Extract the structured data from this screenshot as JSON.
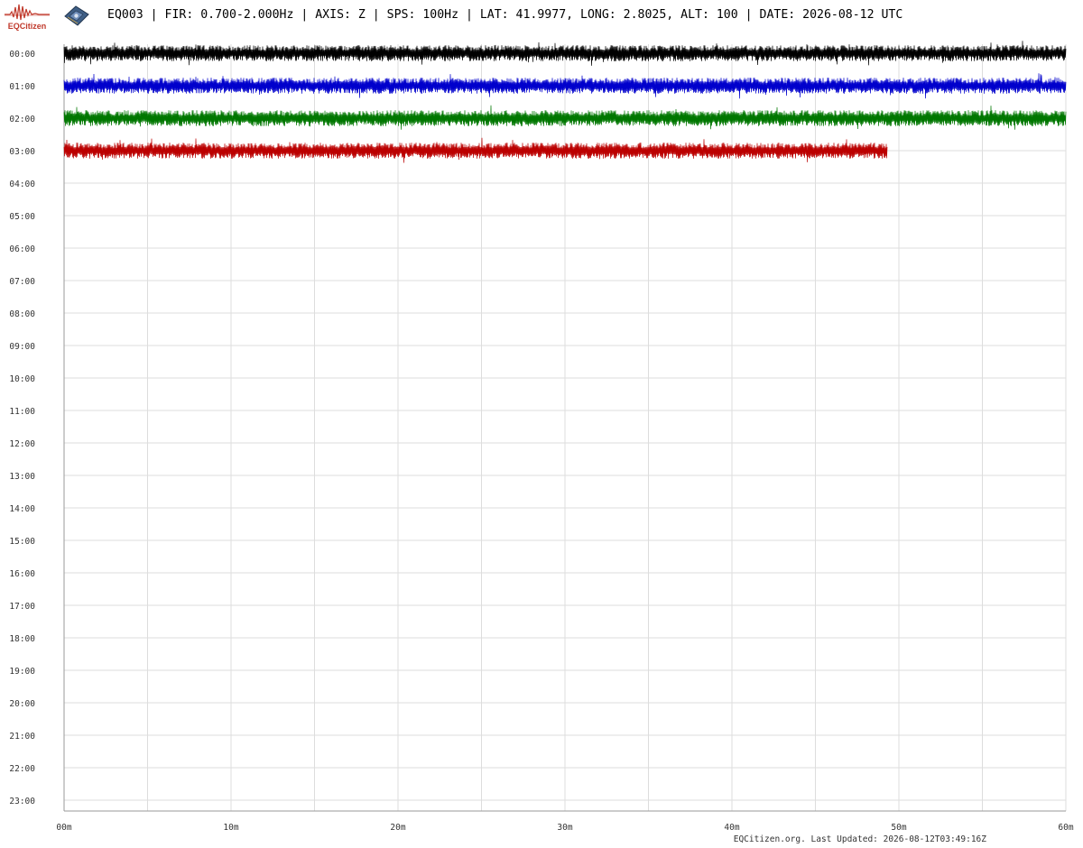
{
  "header": {
    "logo_text": "EQCitizen",
    "title": "EQ003 | FIR: 0.700-2.000Hz | AXIS: Z | SPS: 100Hz | LAT: 41.9977, LONG: 2.8025, ALT: 100 | DATE: 2026-08-12 UTC"
  },
  "footer": {
    "text": "EQCitizen.org. Last Updated: 2026-08-12T03:49:16Z"
  },
  "chart_data": {
    "type": "line",
    "title": "EQ003 | FIR: 0.700-2.000Hz | AXIS: Z | SPS: 100Hz | LAT: 41.9977, LONG: 2.8025, ALT: 100 | DATE: 2026-08-12 UTC",
    "xlabel": "",
    "ylabel": "",
    "x_ticks": [
      "00m",
      "10m",
      "20m",
      "30m",
      "40m",
      "50m",
      "60m"
    ],
    "x_ticks_minutes": [
      0,
      10,
      20,
      30,
      40,
      50,
      60
    ],
    "xlim": [
      0,
      60
    ],
    "y_ticks": [
      "00:00",
      "01:00",
      "02:00",
      "03:00",
      "04:00",
      "05:00",
      "06:00",
      "07:00",
      "08:00",
      "09:00",
      "10:00",
      "11:00",
      "12:00",
      "13:00",
      "14:00",
      "15:00",
      "16:00",
      "17:00",
      "18:00",
      "19:00",
      "20:00",
      "21:00",
      "22:00",
      "23:00"
    ],
    "grid": true,
    "series": [
      {
        "hour": "00:00",
        "start_minute": 0,
        "end_minute": 60,
        "color": "#000000",
        "amplitude": 0.45
      },
      {
        "hour": "01:00",
        "start_minute": 0,
        "end_minute": 60,
        "color": "#0000cc",
        "amplitude": 0.45
      },
      {
        "hour": "02:00",
        "start_minute": 0,
        "end_minute": 60,
        "color": "#007700",
        "amplitude": 0.45
      },
      {
        "hour": "03:00",
        "start_minute": 0,
        "end_minute": 49.3,
        "color": "#bb0000",
        "amplitude": 0.45
      }
    ],
    "colors": {
      "grid": "#dddddd",
      "axis": "#999999",
      "tick_label": "#333333"
    }
  }
}
